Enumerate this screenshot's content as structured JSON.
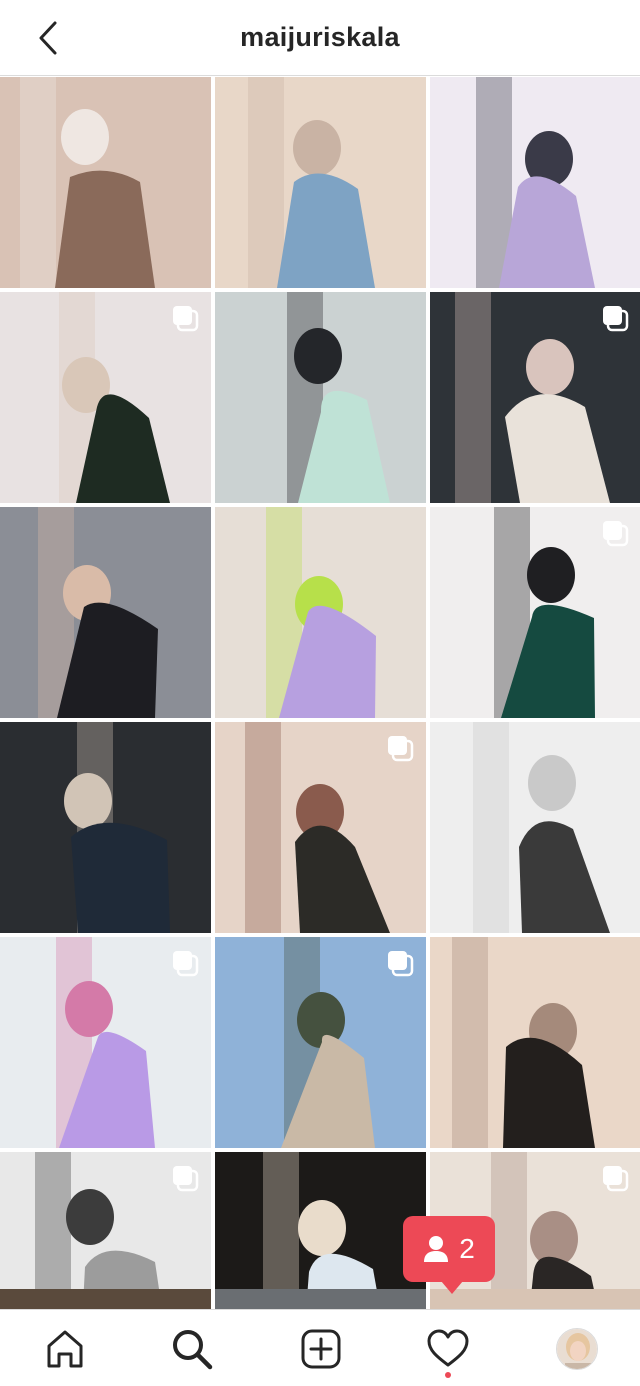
{
  "header": {
    "username": "maijuriskala",
    "back_icon": "chevron-left-icon"
  },
  "grid": {
    "tiles": [
      {
        "id": 1,
        "multi": false,
        "colors": [
          "#d9c2b5",
          "#8a6a5a",
          "#efe7e2"
        ]
      },
      {
        "id": 2,
        "multi": false,
        "colors": [
          "#e8d7c8",
          "#7ea3c4",
          "#c9b3a4"
        ]
      },
      {
        "id": 3,
        "multi": false,
        "colors": [
          "#efeaf2",
          "#b8a6d8",
          "#3a3a48"
        ]
      },
      {
        "id": 4,
        "multi": true,
        "colors": [
          "#e8e2e2",
          "#1e2b22",
          "#d9c7b8"
        ]
      },
      {
        "id": 5,
        "multi": false,
        "colors": [
          "#cbd2d2",
          "#bfe2d6",
          "#24262a"
        ]
      },
      {
        "id": 6,
        "multi": true,
        "colors": [
          "#2e3338",
          "#e9e2da",
          "#d9c4bd"
        ]
      },
      {
        "id": 7,
        "multi": false,
        "colors": [
          "#8b8e96",
          "#1d1d22",
          "#d9bba8"
        ]
      },
      {
        "id": 8,
        "multi": false,
        "colors": [
          "#e6ded6",
          "#b7a0e0",
          "#b7e04a"
        ]
      },
      {
        "id": 9,
        "multi": true,
        "colors": [
          "#f0eeee",
          "#154a40",
          "#1f1f22"
        ]
      },
      {
        "id": 10,
        "multi": false,
        "colors": [
          "#2a2d31",
          "#1f2a38",
          "#d1c4b6"
        ]
      },
      {
        "id": 11,
        "multi": true,
        "colors": [
          "#e6d4c8",
          "#2c2b27",
          "#8a5b4d"
        ]
      },
      {
        "id": 12,
        "multi": false,
        "colors": [
          "#eeeeee",
          "#3a3a3a",
          "#c9c9c9"
        ]
      },
      {
        "id": 13,
        "multi": true,
        "colors": [
          "#e8ecef",
          "#b99ae6",
          "#d47aa8"
        ]
      },
      {
        "id": 14,
        "multi": true,
        "colors": [
          "#8fb2d8",
          "#c9b9a6",
          "#45513f"
        ]
      },
      {
        "id": 15,
        "multi": false,
        "colors": [
          "#ead7c8",
          "#231f1d",
          "#a58a7b"
        ]
      },
      {
        "id": 16,
        "multi": true,
        "colors": [
          "#e8e8e8",
          "#9c9c9c",
          "#3c3c3c"
        ]
      },
      {
        "id": 17,
        "multi": false,
        "colors": [
          "#1c1a18",
          "#dde7ef",
          "#e9dccb"
        ]
      },
      {
        "id": 18,
        "multi": true,
        "colors": [
          "#eae1d8",
          "#2a2625",
          "#a98f85"
        ]
      }
    ]
  },
  "notification": {
    "icon": "person-icon",
    "count": "2"
  },
  "bottom_nav": {
    "items": [
      {
        "name": "home",
        "icon": "home-icon"
      },
      {
        "name": "search",
        "icon": "search-icon"
      },
      {
        "name": "new-post",
        "icon": "plus-square-icon"
      },
      {
        "name": "activity",
        "icon": "heart-icon"
      },
      {
        "name": "profile",
        "icon": "avatar"
      }
    ]
  },
  "colors": {
    "accent_red": "#ed4956",
    "border": "#dbdbdb",
    "text": "#262626"
  }
}
